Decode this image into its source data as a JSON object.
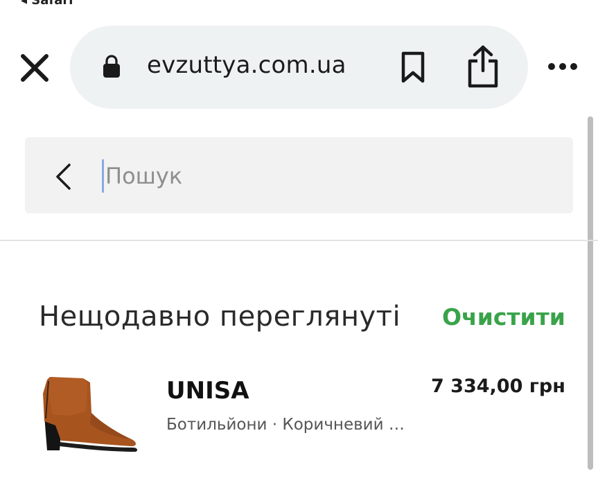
{
  "status_bar": {
    "back_app": "◂ Safari"
  },
  "browser": {
    "url": "evzuttya.com.ua",
    "icons": {
      "close": "close-icon",
      "lock": "lock-icon",
      "bookmark": "bookmark-icon",
      "share": "share-icon",
      "more": "more-icon"
    }
  },
  "search": {
    "placeholder": "Пошук",
    "value": "",
    "back_icon": "chevron-left-icon"
  },
  "recent": {
    "title": "Нещодавно переглянуті",
    "clear_label": "Очистити",
    "accent_color": "#3aa34a",
    "items": [
      {
        "brand": "UNISA",
        "price": "7 334,00 грн",
        "description": "Ботильйони · Коричневий …",
        "image_icon": "ankle-boot-image"
      }
    ]
  }
}
